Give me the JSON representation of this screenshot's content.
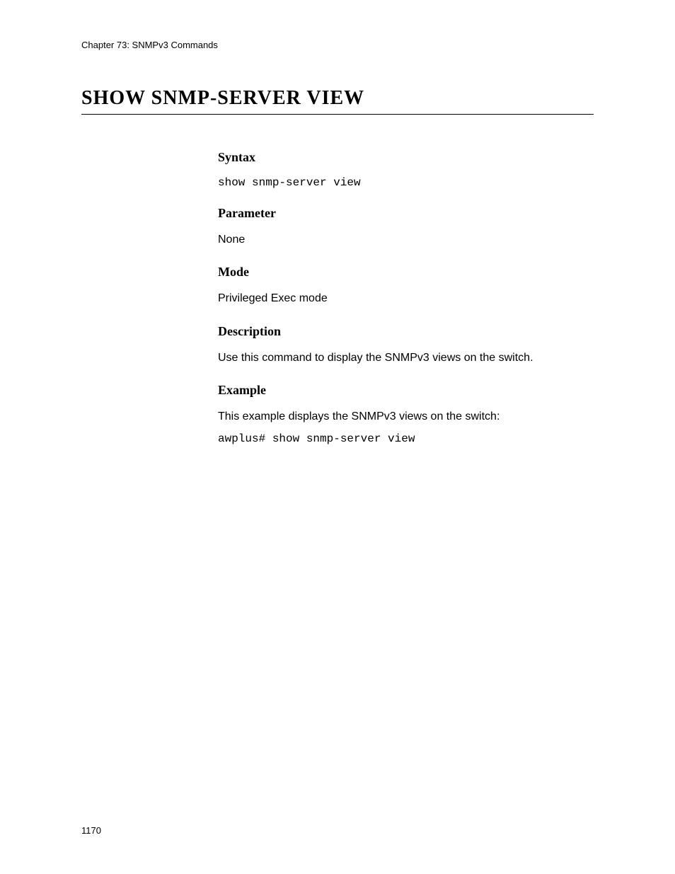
{
  "header": {
    "chapter": "Chapter 73: SNMPv3 Commands"
  },
  "title": "SHOW SNMP-SERVER VIEW",
  "sections": {
    "syntax": {
      "heading": "Syntax",
      "code": "show snmp-server view"
    },
    "parameter": {
      "heading": "Parameter",
      "body": "None"
    },
    "mode": {
      "heading": "Mode",
      "body": "Privileged Exec mode"
    },
    "description": {
      "heading": "Description",
      "body": "Use this command to display the SNMPv3 views on the switch."
    },
    "example": {
      "heading": "Example",
      "body": "This example displays the SNMPv3 views on the switch:",
      "code": "awplus# show snmp-server view"
    }
  },
  "footer": {
    "page_number": "1170"
  }
}
